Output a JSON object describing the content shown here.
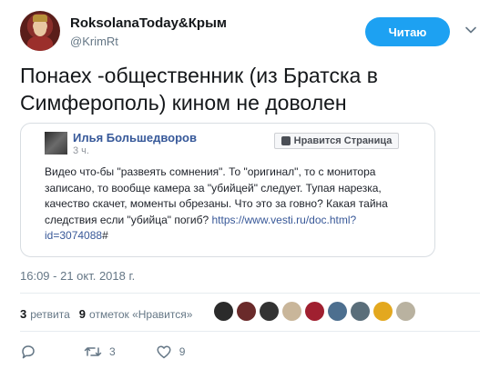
{
  "header": {
    "display_name": "RoksolanaToday&Крым",
    "handle": "@KrimRt",
    "follow_label": "Читаю"
  },
  "tweet": {
    "text": "Понаех -общественник (из Братска в Симферополь) кином не доволен",
    "timestamp": "16:09 - 21 окт. 2018 г."
  },
  "embed": {
    "author": "Илья Большедворов",
    "time": "3 ч.",
    "like_button": "Нравится Страница",
    "body_text": "Видео что-бы \"развеять сомнения\". То \"оригинал\", то с монитора записано, то вообще камера за \"убийцей\" следует. Тупая нарезка, качество скачет, моменты обрезаны. Что это за говно? Какая тайна следствия если \"убийца\" погиб? ",
    "link_text": "https://www.vesti.ru/doc.html?id=3074088",
    "link_suffix": "#"
  },
  "stats": {
    "retweets_count": "3",
    "retweets_label": "ретвита",
    "likes_count": "9",
    "likes_label": "отметок «Нравится»"
  },
  "liker_avatars": [
    "#2b2b2b",
    "#6a2a2a",
    "#333333",
    "#c9b69a",
    "#a02030",
    "#4d6f8f",
    "#5a6e7a",
    "#e3a81f",
    "#b9b2a0"
  ],
  "actions": {
    "reply_count": "",
    "retweet_count": "3",
    "like_count": "9"
  },
  "colors": {
    "accent": "#1da1f2",
    "muted": "#657786",
    "fb_link": "#365899"
  }
}
